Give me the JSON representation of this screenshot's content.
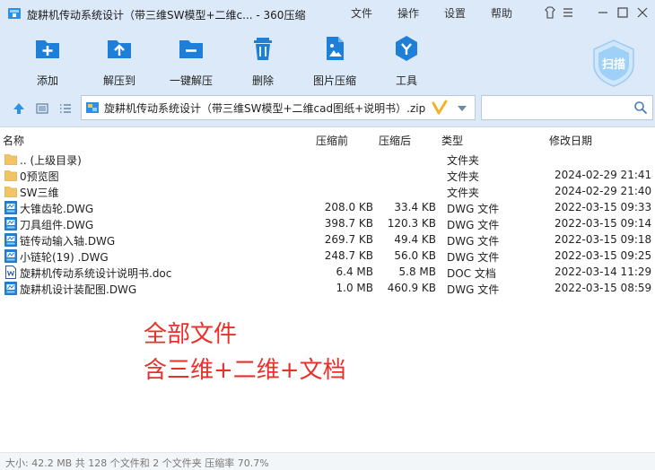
{
  "window": {
    "title": "旋耕机传动系统设计（带三维SW模型+二维c... - 360压缩",
    "menu": [
      "文件",
      "操作",
      "设置",
      "帮助"
    ]
  },
  "toolbar": {
    "buttons": [
      {
        "label": "添加",
        "icon": "add-icon"
      },
      {
        "label": "解压到",
        "icon": "extract-to-icon"
      },
      {
        "label": "一键解压",
        "icon": "one-click-extract-icon"
      },
      {
        "label": "删除",
        "icon": "delete-icon"
      },
      {
        "label": "图片压缩",
        "icon": "image-compress-icon"
      },
      {
        "label": "工具",
        "icon": "tools-icon"
      }
    ],
    "scan_label": "扫描"
  },
  "address": {
    "path": "旋耕机传动系统设计（带三维SW模型+二维cad图纸+说明书）.zip - ",
    "search_placeholder": ""
  },
  "columns": {
    "name": "名称",
    "packed": "压缩前",
    "unpacked": "压缩后",
    "type": "类型",
    "modified": "修改日期"
  },
  "files": [
    {
      "name": ".. (上级目录)",
      "packed": "",
      "unpacked": "",
      "type": "文件夹",
      "modified": "",
      "kind": "folder"
    },
    {
      "name": "0预览图",
      "packed": "",
      "unpacked": "",
      "type": "文件夹",
      "modified": "2024-02-29 21:41",
      "kind": "folder"
    },
    {
      "name": "SW三维",
      "packed": "",
      "unpacked": "",
      "type": "文件夹",
      "modified": "2024-02-29 21:40",
      "kind": "folder"
    },
    {
      "name": "大锥齿轮.DWG",
      "packed": "208.0 KB",
      "unpacked": "33.4 KB",
      "type": "DWG 文件",
      "modified": "2022-03-15 09:33",
      "kind": "dwg"
    },
    {
      "name": "刀具组件.DWG",
      "packed": "398.7 KB",
      "unpacked": "120.3 KB",
      "type": "DWG 文件",
      "modified": "2022-03-15 09:14",
      "kind": "dwg"
    },
    {
      "name": "链传动输入轴.DWG",
      "packed": "269.7 KB",
      "unpacked": "49.4 KB",
      "type": "DWG 文件",
      "modified": "2022-03-15 09:18",
      "kind": "dwg"
    },
    {
      "name": "小链轮(19)  .DWG",
      "packed": "248.7 KB",
      "unpacked": "56.0 KB",
      "type": "DWG 文件",
      "modified": "2022-03-15 09:25",
      "kind": "dwg"
    },
    {
      "name": "旋耕机传动系统设计说明书.doc",
      "packed": "6.4 MB",
      "unpacked": "5.8 MB",
      "type": "DOC 文档",
      "modified": "2022-03-14 11:29",
      "kind": "doc"
    },
    {
      "name": "旋耕机设计装配图.DWG",
      "packed": "1.0 MB",
      "unpacked": "460.9 KB",
      "type": "DWG 文件",
      "modified": "2022-03-15 08:59",
      "kind": "dwg"
    }
  ],
  "overlay": {
    "line1": "全部文件",
    "line2": "含三维+二维+文档"
  },
  "status": {
    "text": "大小: 42.2 MB 共 128 个文件和 2 个文件夹 压缩率 70.7%"
  },
  "colors": {
    "chrome": "#dbe9f8",
    "accent": "#1d7fd8",
    "overlay_text": "#e8302b",
    "folder": "#f3c463"
  }
}
